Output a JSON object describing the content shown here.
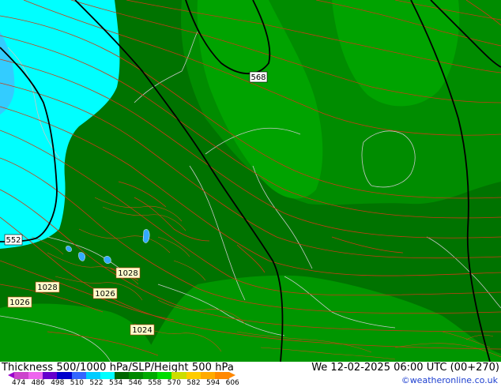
{
  "title": "Thickness 500/1000 hPa/SLP/Height 500 hPa",
  "datetime": "We 12-02-2025 06:00 UTC (00+270)",
  "credit": "©weatheronline.co.uk",
  "map_labels": {
    "height_568": "568",
    "height_552": "552",
    "slp_1028_a": "1028",
    "slp_1028_b": "1028",
    "slp_1026_a": "1026",
    "slp_1026_b": "1026",
    "slp_1024": "1024"
  },
  "legend": {
    "ticks": [
      "474",
      "486",
      "498",
      "510",
      "522",
      "534",
      "546",
      "558",
      "570",
      "582",
      "594",
      "606"
    ],
    "colors": [
      "#cc44cc",
      "#ee66ee",
      "#6600cc",
      "#0000cc",
      "#3366ff",
      "#00ccff",
      "#00ffff",
      "#006600",
      "#008800",
      "#00aa00",
      "#00dd00",
      "#ccdd00",
      "#ffcc00",
      "#ffaa00",
      "#ff8800"
    ]
  },
  "colors": {
    "cyan_light": "#00ffff",
    "cyan_mid": "#33ccff",
    "green_dark": "#006600",
    "green_mid": "#008800",
    "green_light": "#00a300",
    "contour_red": "#cc3300",
    "height_black": "#000000",
    "border_gray": "#cccccc"
  }
}
